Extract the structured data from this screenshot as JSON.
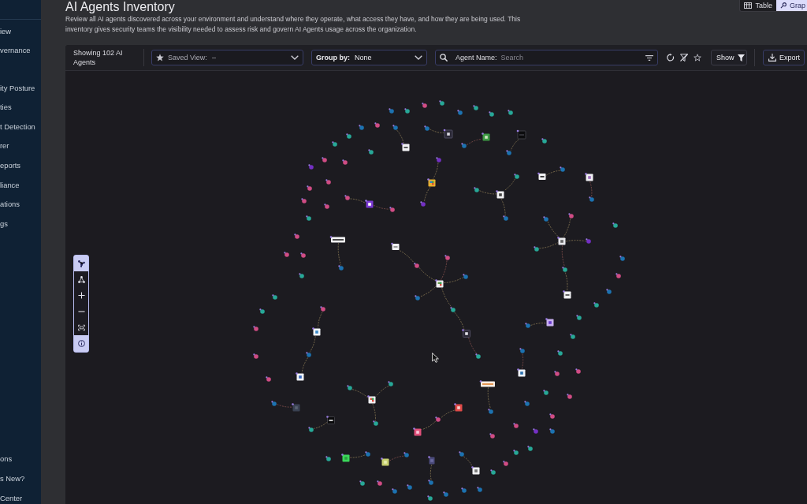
{
  "sidebar": {
    "sections": [
      {
        "items": [
          "iew",
          "vernance"
        ]
      },
      {
        "items": [
          "ity Posture",
          "ties",
          "t Detection",
          "rer",
          "eports",
          "liance",
          "ations",
          "gs"
        ]
      }
    ],
    "footer_items": [
      "ons",
      "s New?",
      "Center"
    ]
  },
  "header": {
    "title": "AI Agents Inventory",
    "description": "Review all AI agents discovered across your environment and understand where they operate, what access they have, and how they are being used. This inventory gives security teams the visibility needed to assess risk and govern AI Agents usage across the organization.",
    "view_toggle": [
      {
        "kind": "table",
        "label": "Table",
        "selected": false
      },
      {
        "kind": "graph",
        "label": "Grap",
        "selected": true
      }
    ]
  },
  "toolbar": {
    "count": "Showing 102 AI Agents",
    "saved_view": {
      "label": "Saved View:",
      "value": "–"
    },
    "group_by": {
      "label": "Group by:",
      "value": "None"
    },
    "search": {
      "label": "Agent Name:",
      "placeholder": "Search"
    },
    "show_button": "Show",
    "export_button": "Export"
  },
  "graph_controls": [
    {
      "kind": "layout",
      "selected": true
    },
    {
      "kind": "hierarchy",
      "selected": false
    },
    {
      "kind": "zoomin",
      "selected": false
    },
    {
      "kind": "zoomout",
      "selected": false
    },
    {
      "kind": "fit",
      "selected": false
    },
    {
      "kind": "info",
      "selected": true
    }
  ]
}
